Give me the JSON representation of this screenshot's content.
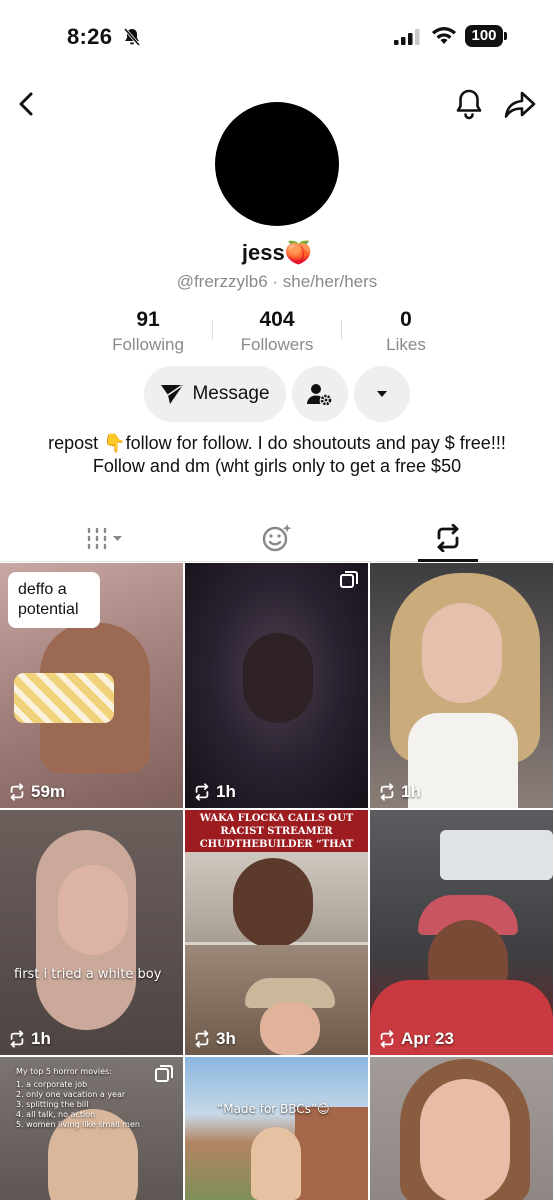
{
  "status_bar": {
    "time": "8:26",
    "battery": "100"
  },
  "profile": {
    "name": "jess🍑",
    "handle": "@frerzzylb6",
    "pronouns": "she/her/hers",
    "separator": "·",
    "bio": "repost 👇follow for follow. I do shoutouts and pay $ free!!! Follow and dm (wht girls only to get a free $50"
  },
  "stats": [
    {
      "value": "91",
      "label": "Following"
    },
    {
      "value": "404",
      "label": "Followers"
    },
    {
      "value": "0",
      "label": "Likes"
    }
  ],
  "actions": {
    "message_label": "Message"
  },
  "tabs": [
    {
      "icon": "grid-icon"
    },
    {
      "icon": "favorites-icon"
    },
    {
      "icon": "repost-icon",
      "active": true
    }
  ],
  "grid": [
    {
      "time": "59m",
      "caption": "deffo a potential"
    },
    {
      "time": "1h",
      "multi": true
    },
    {
      "time": "1h"
    },
    {
      "time": "1h",
      "caption": "first i tried a white boy"
    },
    {
      "time": "3h",
      "caption": "WAKA FLOCKA CALLS OUT RACIST STREAMER CHUDTHEBUILDER “THAT SH*T LAME AF”"
    },
    {
      "time": "Apr 23"
    },
    {
      "caption_title": "My top 5 horror movies:",
      "caption_lines": [
        "1. a corporate job",
        "2. only one vacation a year",
        "3. splitting the bill",
        "4. all talk, no action",
        "5. women living like small men"
      ],
      "multi": true
    },
    {
      "caption": "“Made for BBCs”😊"
    },
    {}
  ],
  "colors": {
    "accent": "#111111",
    "muted": "#8a8a8a",
    "button_bg": "#efefef"
  }
}
